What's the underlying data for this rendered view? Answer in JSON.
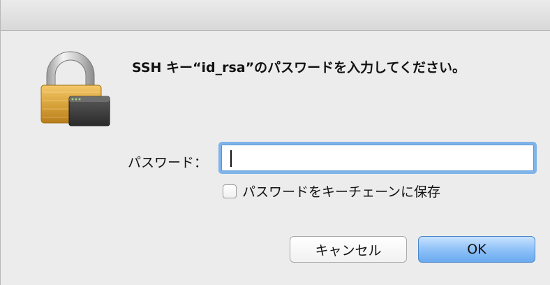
{
  "dialog": {
    "message": "SSH キー“id_rsa”のパスワードを入力してください。",
    "password_label": "パスワード：",
    "password_value": "",
    "remember_label": "パスワードをキーチェーンに保存",
    "remember_checked": false,
    "cancel_label": "キャンセル",
    "ok_label": "OK"
  },
  "icons": {
    "lock": "padlock-with-terminal-icon"
  },
  "colors": {
    "focus_ring": "#7eb4ea",
    "default_button": "#8fc2f7",
    "lock_body": "#d9a43b"
  }
}
